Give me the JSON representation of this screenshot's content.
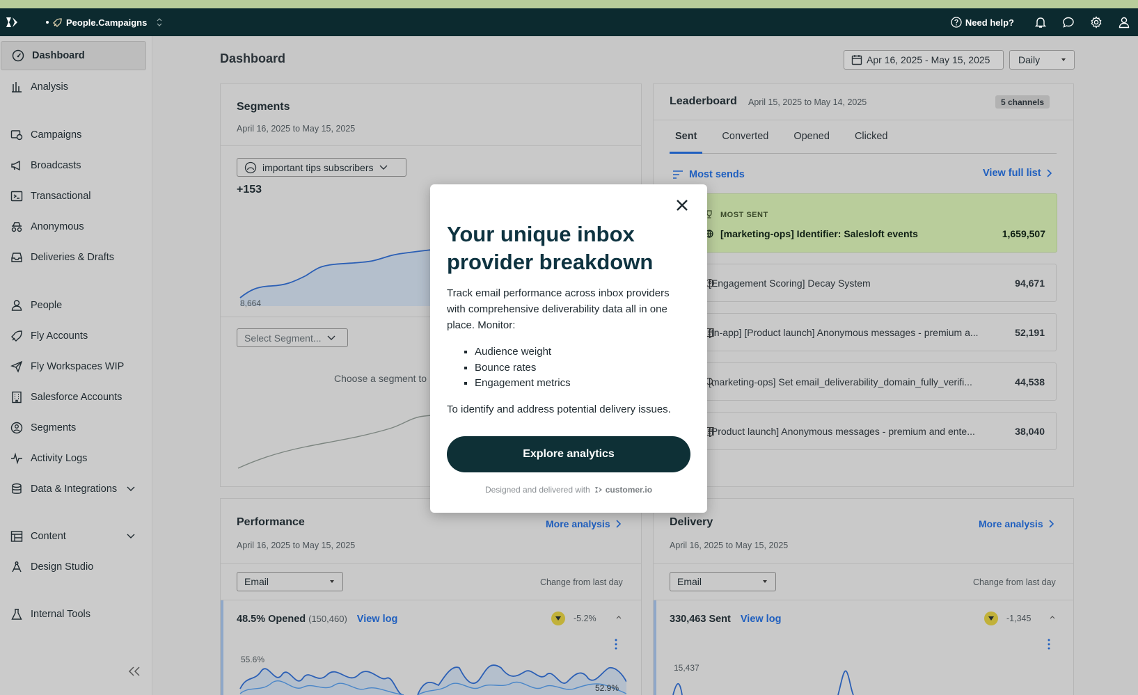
{
  "topbar": {
    "workspace": "People.Campaigns",
    "help": "Need help?"
  },
  "sidebar": {
    "items": [
      {
        "label": "Dashboard"
      },
      {
        "label": "Analysis"
      },
      {
        "label": "Campaigns"
      },
      {
        "label": "Broadcasts"
      },
      {
        "label": "Transactional"
      },
      {
        "label": "Anonymous"
      },
      {
        "label": "Deliveries & Drafts"
      },
      {
        "label": "People"
      },
      {
        "label": "Fly Accounts"
      },
      {
        "label": "Fly Workspaces WIP"
      },
      {
        "label": "Salesforce Accounts"
      },
      {
        "label": "Segments"
      },
      {
        "label": "Activity Logs"
      },
      {
        "label": "Data & Integrations"
      },
      {
        "label": "Content"
      },
      {
        "label": "Design Studio"
      },
      {
        "label": "Internal Tools"
      }
    ]
  },
  "header": {
    "title": "Dashboard",
    "date_range": "Apr 16, 2025 - May 15, 2025",
    "frequency": "Daily"
  },
  "segments": {
    "title": "Segments",
    "range": "April 16, 2025 to May 15, 2025",
    "segment_select": "important tips subscribers",
    "delta": "+153",
    "start_value": "8,664",
    "second_select": "Select Segment...",
    "empty_hint": "Choose a segment to"
  },
  "leaderboard": {
    "title": "Leaderboard",
    "range": "April 15, 2025 to May 14, 2025",
    "badge": "5 channels",
    "tabs": [
      "Sent",
      "Converted",
      "Opened",
      "Clicked"
    ],
    "sort_label": "Most sends",
    "view_full": "View full list",
    "top_label": "MOST SENT",
    "top_name": "[marketing-ops] Identifier: Salesloft events",
    "top_value": "1,659,507",
    "rows": [
      {
        "name": "[Engagement Scoring] Decay System",
        "value": "94,671"
      },
      {
        "name": "[In-app] [Product launch] Anonymous messages - premium a...",
        "value": "52,191"
      },
      {
        "name": "[marketing-ops] Set email_deliverability_domain_fully_verifi...",
        "value": "44,538"
      },
      {
        "name": "[Product launch] Anonymous messages - premium and ente...",
        "value": "38,040"
      }
    ]
  },
  "performance": {
    "title": "Performance",
    "more": "More analysis",
    "range": "April 16, 2025 to May 15, 2025",
    "channel": "Email",
    "change_label": "Change from last day",
    "metric": "48.5% Opened",
    "metric_count": "(150,460)",
    "view_log": "View log",
    "delta": "-5.2%",
    "y_top": "55.6%",
    "y_end": "52.9%"
  },
  "delivery": {
    "title": "Delivery",
    "more": "More analysis",
    "range": "April 16, 2025 to May 15, 2025",
    "channel": "Email",
    "change_label": "Change from last day",
    "metric": "330,463 Sent",
    "view_log": "View log",
    "delta": "-1,345",
    "y_top": "15,437"
  },
  "modal": {
    "title": "Your unique inbox provider breakdown",
    "body": "Track email performance across inbox providers with comprehensive deliverability data all in one place. Monitor:",
    "bullets": [
      "Audience weight",
      "Bounce rates",
      "Engagement metrics"
    ],
    "after": "To identify and address potential delivery issues.",
    "cta": "Explore analytics",
    "footer": "Designed and delivered with",
    "brand": "customer.io"
  },
  "colors": {
    "topbar": "#0c2a2f",
    "accent": "#1f5fbf",
    "highlight": "#b9cd9b",
    "cta": "#0e3036"
  }
}
